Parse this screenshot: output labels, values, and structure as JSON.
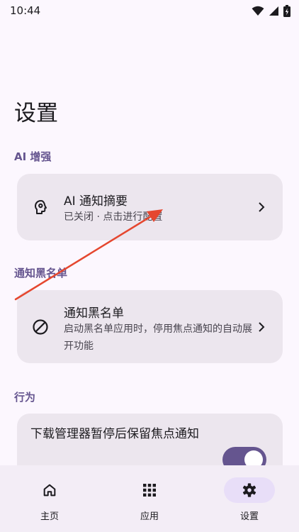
{
  "status_bar": {
    "time": "10:44"
  },
  "page": {
    "title": "设置"
  },
  "sections": {
    "ai": {
      "header": "AI 增强",
      "item": {
        "title": "AI 通知摘要",
        "subtitle": "已关闭 · 点击进行配置",
        "icon": "brain-head-icon"
      }
    },
    "blacklist": {
      "header": "通知黑名单",
      "item": {
        "title": "通知黑名单",
        "subtitle": "启动黑名单应用时，停用焦点通知的自动展开功能",
        "icon": "block-icon"
      }
    },
    "behavior": {
      "header": "行为",
      "item": {
        "title": "下载管理器暂停后保留焦点通知",
        "toggle_on": true
      }
    }
  },
  "bottom_nav": {
    "items": [
      {
        "label": "主页",
        "icon": "home-icon",
        "active": false
      },
      {
        "label": "应用",
        "icon": "apps-grid-icon",
        "active": false
      },
      {
        "label": "设置",
        "icon": "gear-icon",
        "active": true
      }
    ]
  },
  "colors": {
    "accent": "#65558F",
    "card": "#ECE6EE",
    "background": "#FCF7FE",
    "annotation": "#E5472F"
  }
}
